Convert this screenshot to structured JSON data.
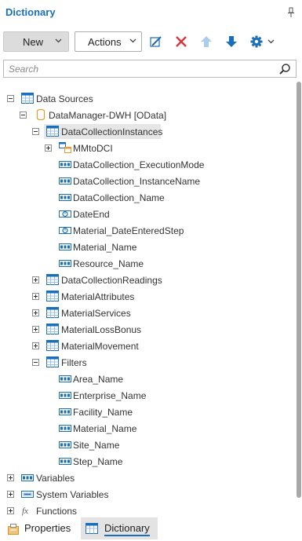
{
  "panel": {
    "title": "Dictionary"
  },
  "toolbar": {
    "new_label": "New",
    "actions_label": "Actions"
  },
  "search": {
    "placeholder": "Search"
  },
  "tree": {
    "rows": [
      {
        "label": "Data Sources"
      },
      {
        "label": "DataManager-DWH [OData]"
      },
      {
        "label": "DataCollectionInstances"
      },
      {
        "label": "MMtoDCI"
      },
      {
        "label": "DataCollection_ExecutionMode"
      },
      {
        "label": "DataCollection_InstanceName"
      },
      {
        "label": "DataCollection_Name"
      },
      {
        "label": "DateEnd"
      },
      {
        "label": "Material_DateEnteredStep"
      },
      {
        "label": "Material_Name"
      },
      {
        "label": "Resource_Name"
      },
      {
        "label": "DataCollectionReadings"
      },
      {
        "label": "MaterialAttributes"
      },
      {
        "label": "MaterialServices"
      },
      {
        "label": "MaterialLossBonus"
      },
      {
        "label": "MaterialMovement"
      },
      {
        "label": "Filters"
      },
      {
        "label": "Area_Name"
      },
      {
        "label": "Enterprise_Name"
      },
      {
        "label": "Facility_Name"
      },
      {
        "label": "Material_Name"
      },
      {
        "label": "Site_Name"
      },
      {
        "label": "Step_Name"
      },
      {
        "label": "Variables"
      },
      {
        "label": "System Variables"
      },
      {
        "label": "Functions"
      }
    ]
  },
  "tabs": {
    "properties_label": "Properties",
    "dictionary_label": "Dictionary"
  },
  "colors": {
    "accent": "#1a6fba",
    "delete": "#e0323a",
    "folder_orange": "#e89a2c"
  }
}
